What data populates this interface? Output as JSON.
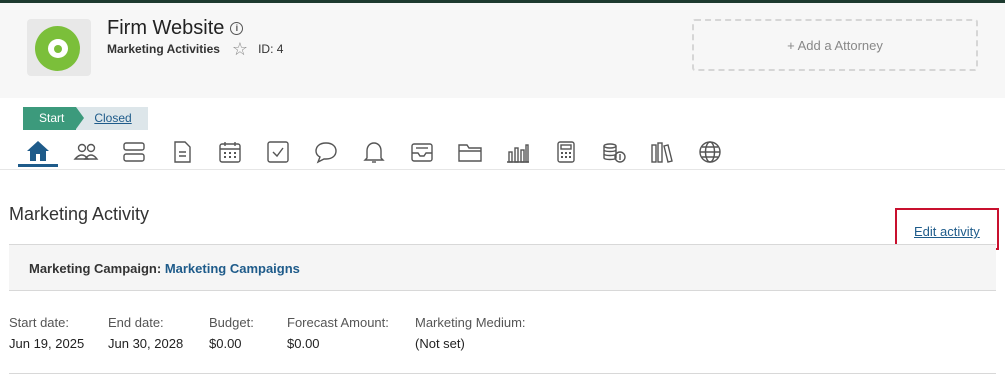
{
  "header": {
    "title": "Firm Website",
    "subtitle": "Marketing Activities",
    "id_label": "ID: 4",
    "add_attorney_label": "+ Add a Attorney",
    "logo_color": "#7bbf3a"
  },
  "stages": {
    "start_label": "Start",
    "closed_label": "Closed",
    "start_color": "#3c9a7c"
  },
  "nav_icons": [
    "home-icon",
    "people-icon",
    "stack-icon",
    "document-icon",
    "calendar-icon",
    "checkbox-icon",
    "chat-icon",
    "bell-icon",
    "inbox-icon",
    "folder-icon",
    "bar-chart-icon",
    "calculator-icon",
    "coins-icon",
    "library-icon",
    "globe-icon"
  ],
  "main": {
    "section_title": "Marketing Activity",
    "edit_label": "Edit activity",
    "campaign_label": "Marketing Campaign:",
    "campaign_value": "Marketing Campaigns",
    "fields": [
      {
        "label": "Start date:",
        "value": "Jun 19, 2025"
      },
      {
        "label": "End date:",
        "value": "Jun 30, 2028"
      },
      {
        "label": "Budget:",
        "value": "$0.00"
      },
      {
        "label": "Forecast Amount:",
        "value": "$0.00"
      },
      {
        "label": "Marketing Medium:",
        "value": "(Not set)"
      }
    ]
  },
  "colors": {
    "link": "#1e5b8a",
    "highlight_box": "#c8102e"
  }
}
